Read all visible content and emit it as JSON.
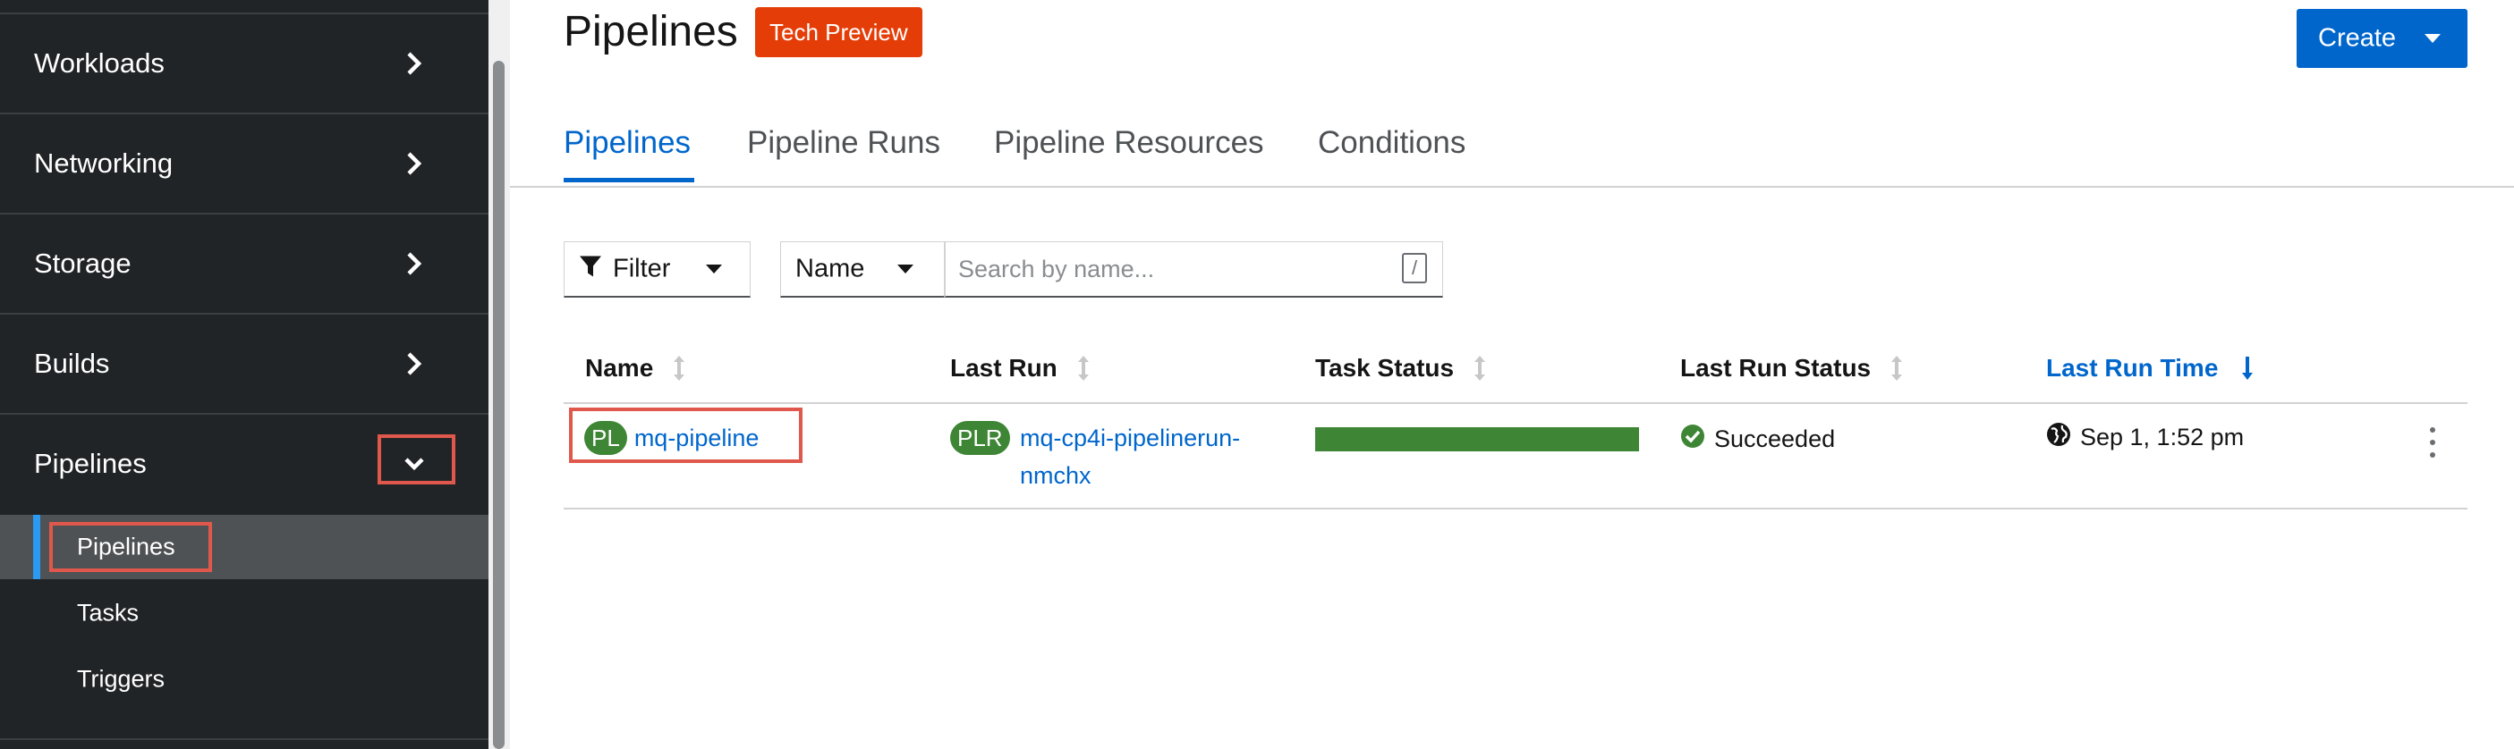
{
  "sidebar": {
    "items": [
      {
        "label": "Workloads",
        "icon": "chevron-right-icon"
      },
      {
        "label": "Networking",
        "icon": "chevron-right-icon"
      },
      {
        "label": "Storage",
        "icon": "chevron-right-icon"
      },
      {
        "label": "Builds",
        "icon": "chevron-right-icon"
      },
      {
        "label": "Pipelines",
        "icon": "chevron-down-icon",
        "expanded": true
      }
    ],
    "subitems": [
      {
        "label": "Pipelines",
        "active": true
      },
      {
        "label": "Tasks"
      },
      {
        "label": "Triggers"
      }
    ]
  },
  "page": {
    "title": "Pipelines",
    "badge": "Tech Preview",
    "create_label": "Create"
  },
  "tabs": [
    {
      "label": "Pipelines",
      "active": true
    },
    {
      "label": "Pipeline Runs"
    },
    {
      "label": "Pipeline Resources"
    },
    {
      "label": "Conditions"
    }
  ],
  "toolbar": {
    "filter_label": "Filter",
    "name_select": "Name",
    "search_placeholder": "Search by name...",
    "search_shortcut": "/"
  },
  "table": {
    "columns": [
      "Name",
      "Last Run",
      "Task Status",
      "Last Run Status",
      "Last Run Time"
    ],
    "sorted_column": "Last Run Time",
    "rows": [
      {
        "name_badge": "PL",
        "name": "mq-pipeline",
        "last_run_badge": "PLR",
        "last_run_line1": "mq-cp4i-pipelinerun-",
        "last_run_line2": "nmchx",
        "task_status_fraction": 1.0,
        "status": "Succeeded",
        "time": "Sep 1, 1:52 pm"
      }
    ]
  },
  "colors": {
    "sidebar_bg": "#212427",
    "accent": "#0066cc",
    "badge": "#e53d08",
    "success": "#3e8635",
    "highlight": "#e0584b"
  }
}
